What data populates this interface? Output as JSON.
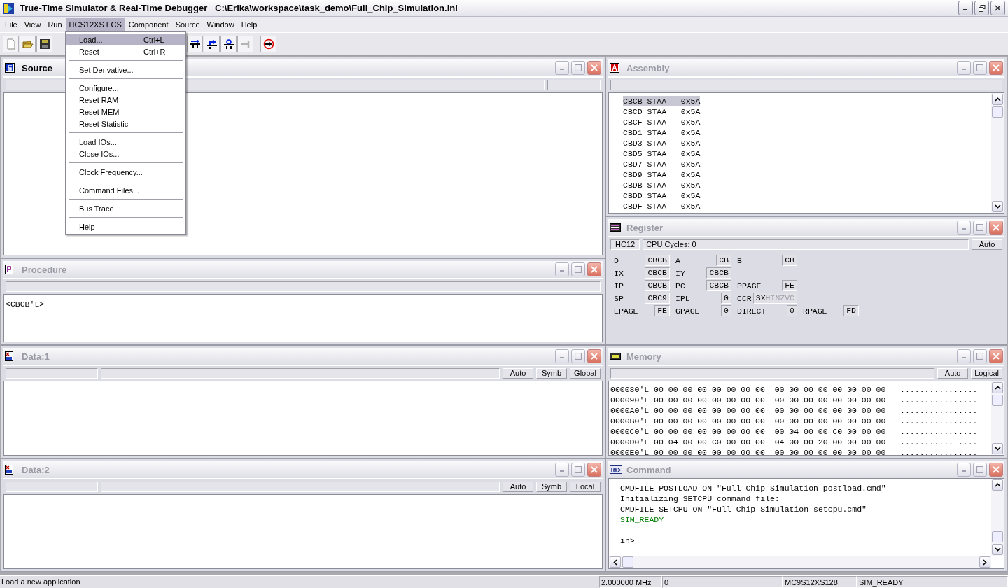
{
  "window": {
    "title": "True-Time Simulator & Real-Time Debugger   C:\\Erika\\workspace\\task_demo\\Full_Chip_Simulation.ini"
  },
  "menu": [
    {
      "label": "File",
      "selected": false
    },
    {
      "label": "View",
      "selected": false
    },
    {
      "label": "Run",
      "selected": false
    },
    {
      "label": "HCS12XS FCS",
      "selected": true
    },
    {
      "label": "Component",
      "selected": false
    },
    {
      "label": "Source",
      "selected": false
    },
    {
      "label": "Window",
      "selected": false
    },
    {
      "label": "Help",
      "selected": false
    }
  ],
  "open_menu": {
    "items": [
      {
        "kind": "item",
        "label": "Load...",
        "shortcut": "Ctrl+L",
        "selected": true
      },
      {
        "kind": "item",
        "label": "Reset",
        "shortcut": "Ctrl+R",
        "selected": false
      },
      {
        "kind": "separator"
      },
      {
        "kind": "item",
        "label": "Set Derivative...",
        "selected": false
      },
      {
        "kind": "separator"
      },
      {
        "kind": "item",
        "label": "Configure...",
        "selected": false
      },
      {
        "kind": "item",
        "label": "Reset RAM",
        "selected": false
      },
      {
        "kind": "item",
        "label": "Reset MEM",
        "selected": false
      },
      {
        "kind": "item",
        "label": "Reset Statistic",
        "selected": false
      },
      {
        "kind": "separator"
      },
      {
        "kind": "item",
        "label": "Load IOs...",
        "selected": false
      },
      {
        "kind": "item",
        "label": "Close IOs...",
        "selected": false
      },
      {
        "kind": "separator"
      },
      {
        "kind": "item",
        "label": "Clock Frequency...",
        "selected": false
      },
      {
        "kind": "separator"
      },
      {
        "kind": "item",
        "label": "Command Files...",
        "selected": false
      },
      {
        "kind": "separator"
      },
      {
        "kind": "item",
        "label": "Bus Trace",
        "selected": false
      },
      {
        "kind": "separator"
      },
      {
        "kind": "item",
        "label": "Help",
        "selected": false
      }
    ]
  },
  "toolbar": [
    {
      "buttons": [
        {
          "kind": "new",
          "disabled": false
        },
        {
          "kind": "open",
          "disabled": false
        },
        {
          "kind": "save",
          "disabled": false
        }
      ]
    },
    {
      "buttons": [
        {
          "kind": "step-over",
          "disabled": false
        },
        {
          "kind": "step-out",
          "disabled": false
        },
        {
          "kind": "assembly-step",
          "disabled": false
        },
        {
          "kind": "halt",
          "disabled": true
        }
      ]
    },
    {
      "buttons": [
        {
          "kind": "reset",
          "disabled": false
        }
      ]
    }
  ],
  "left_column": [
    {
      "kind": "source",
      "title": "Source",
      "header": [
        {
          "kind": "blank"
        },
        {
          "kind": "field"
        }
      ]
    },
    {
      "kind": "procedure",
      "title": "Procedure",
      "header": [
        {
          "kind": "blank"
        }
      ],
      "lines": [
        "<CBCB'L>"
      ]
    },
    {
      "kind": "data",
      "title": "Data:1",
      "header": [
        {
          "kind": "field"
        },
        {
          "kind": "blank"
        },
        {
          "kind": "button",
          "text": "Auto"
        },
        {
          "kind": "button",
          "text": "Symb"
        },
        {
          "kind": "button",
          "text": "Global"
        }
      ]
    },
    {
      "kind": "data",
      "title": "Data:2",
      "header": [
        {
          "kind": "field"
        },
        {
          "kind": "blank"
        },
        {
          "kind": "button",
          "text": "Auto"
        },
        {
          "kind": "button",
          "text": "Symb"
        },
        {
          "kind": "button",
          "text": "Local"
        }
      ]
    }
  ],
  "right_column": [
    {
      "kind": "assembly",
      "title": "Assembly",
      "header": [
        {
          "kind": "blank"
        }
      ],
      "vscroll": true,
      "lines": [
        {
          "address": "CBCB",
          "mnemonic": "STAA",
          "operand": "0x5A",
          "selected": true
        },
        {
          "address": "CBCD",
          "mnemonic": "STAA",
          "operand": "0x5A",
          "selected": false
        },
        {
          "address": "CBCF",
          "mnemonic": "STAA",
          "operand": "0x5A",
          "selected": false
        },
        {
          "address": "CBD1",
          "mnemonic": "STAA",
          "operand": "0x5A",
          "selected": false
        },
        {
          "address": "CBD3",
          "mnemonic": "STAA",
          "operand": "0x5A",
          "selected": false
        },
        {
          "address": "CBD5",
          "mnemonic": "STAA",
          "operand": "0x5A",
          "selected": false
        },
        {
          "address": "CBD7",
          "mnemonic": "STAA",
          "operand": "0x5A",
          "selected": false
        },
        {
          "address": "CBD9",
          "mnemonic": "STAA",
          "operand": "0x5A",
          "selected": false
        },
        {
          "address": "CBDB",
          "mnemonic": "STAA",
          "operand": "0x5A",
          "selected": false
        },
        {
          "address": "CBDD",
          "mnemonic": "STAA",
          "operand": "0x5A",
          "selected": false
        },
        {
          "address": "CBDF",
          "mnemonic": "STAA",
          "operand": "0x5A",
          "selected": false
        }
      ]
    },
    {
      "kind": "register",
      "title": "Register",
      "header": [
        {
          "kind": "label",
          "text": "HC12"
        },
        {
          "kind": "wide-label",
          "text": "CPU Cycles:  0"
        },
        {
          "kind": "button",
          "text": "Auto"
        }
      ],
      "rows": [
        [
          {
            "label": "D",
            "value": "CBCB"
          },
          {
            "label": "A",
            "value": "CB"
          },
          {
            "label": "B",
            "value": "CB"
          }
        ],
        [
          {
            "label": "IX",
            "value": "CBCB"
          },
          {
            "label": "IY",
            "value": "CBCB"
          }
        ],
        [
          {
            "label": "IP",
            "value": "CBCB"
          },
          {
            "label": "PC",
            "value": "CBCB"
          },
          {
            "label": "PPAGE",
            "value": "FE"
          }
        ],
        [
          {
            "label": "SP",
            "value": "CBC9"
          },
          {
            "label": "IPL",
            "value": "0"
          },
          {
            "label": "CCR",
            "flags": [
              {
                "letter": "S",
                "on": true
              },
              {
                "letter": "X",
                "on": true
              },
              {
                "letter": "H",
                "on": false
              },
              {
                "letter": "I",
                "on": false
              },
              {
                "letter": "N",
                "on": false
              },
              {
                "letter": "Z",
                "on": false
              },
              {
                "letter": "V",
                "on": false
              },
              {
                "letter": "C",
                "on": false
              }
            ]
          }
        ],
        [
          {
            "label": "EPAGE",
            "value": "FE"
          },
          {
            "label": "GPAGE",
            "value": "0"
          },
          {
            "label": "DIRECT",
            "value": "0"
          },
          {
            "label": "RPAGE",
            "value": "FD"
          }
        ]
      ]
    },
    {
      "kind": "memory",
      "title": "Memory",
      "header": [
        {
          "kind": "blank"
        },
        {
          "kind": "button",
          "text": "Auto"
        },
        {
          "kind": "button",
          "text": "Logical"
        }
      ],
      "vscroll": true,
      "lines": [
        "000080'L 00 00 00 00 00 00 00 00  00 00 00 00 00 00 00 00   ................",
        "000090'L 00 00 00 00 00 00 00 00  00 00 00 00 00 00 00 00   ................",
        "0000A0'L 00 00 00 00 00 00 00 00  00 00 00 00 00 00 00 00   ................",
        "0000B0'L 00 00 00 00 00 00 00 00  00 00 00 00 00 00 00 00   ................",
        "0000C0'L 00 00 00 00 00 00 00 00  00 04 00 00 C0 00 00 00   ................",
        "0000D0'L 00 04 00 00 C0 00 00 00  04 00 00 20 00 00 00 00   ........... ....",
        "0000E0'L 00 00 00 00 00 00 00 00  00 00 00 00 00 00 00 00   ................"
      ]
    },
    {
      "kind": "command",
      "title": "Command",
      "vscroll": true,
      "hscroll": true,
      "lines": [
        {
          "kind": "output",
          "text": "CMDFILE POSTLOAD ON \"Full_Chip_Simulation_postload.cmd\"",
          "color": "#000000"
        },
        {
          "kind": "output",
          "text": "Initializing SETCPU command file:",
          "color": "#000000"
        },
        {
          "kind": "output",
          "text": "CMDFILE SETCPU ON \"Full_Chip_Simulation_setcpu.cmd\"",
          "color": "#000000"
        },
        {
          "kind": "output",
          "text": "SIM_READY",
          "color": "#008000"
        },
        {
          "kind": "prompt",
          "text": "in>",
          "color": "#000000"
        }
      ]
    }
  ],
  "status_bar": [
    {
      "text": "Load a new application"
    },
    {
      "text": "2.000000 MHz"
    },
    {
      "text": "0"
    },
    {
      "text": "MC9S12XS128"
    },
    {
      "text": "SIM_READY"
    }
  ]
}
